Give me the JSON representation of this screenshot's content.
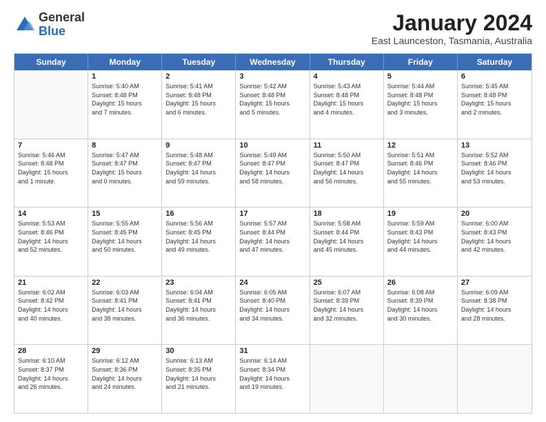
{
  "logo": {
    "general": "General",
    "blue": "Blue"
  },
  "title": "January 2024",
  "subtitle": "East Launceston, Tasmania, Australia",
  "header_days": [
    "Sunday",
    "Monday",
    "Tuesday",
    "Wednesday",
    "Thursday",
    "Friday",
    "Saturday"
  ],
  "weeks": [
    [
      {
        "day": "",
        "text": ""
      },
      {
        "day": "1",
        "text": "Sunrise: 5:40 AM\nSunset: 8:48 PM\nDaylight: 15 hours\nand 7 minutes."
      },
      {
        "day": "2",
        "text": "Sunrise: 5:41 AM\nSunset: 8:48 PM\nDaylight: 15 hours\nand 6 minutes."
      },
      {
        "day": "3",
        "text": "Sunrise: 5:42 AM\nSunset: 8:48 PM\nDaylight: 15 hours\nand 5 minutes."
      },
      {
        "day": "4",
        "text": "Sunrise: 5:43 AM\nSunset: 8:48 PM\nDaylight: 15 hours\nand 4 minutes."
      },
      {
        "day": "5",
        "text": "Sunrise: 5:44 AM\nSunset: 8:48 PM\nDaylight: 15 hours\nand 3 minutes."
      },
      {
        "day": "6",
        "text": "Sunrise: 5:45 AM\nSunset: 8:48 PM\nDaylight: 15 hours\nand 2 minutes."
      }
    ],
    [
      {
        "day": "7",
        "text": "Sunrise: 5:46 AM\nSunset: 8:48 PM\nDaylight: 15 hours\nand 1 minute."
      },
      {
        "day": "8",
        "text": "Sunrise: 5:47 AM\nSunset: 8:47 PM\nDaylight: 15 hours\nand 0 minutes."
      },
      {
        "day": "9",
        "text": "Sunrise: 5:48 AM\nSunset: 8:47 PM\nDaylight: 14 hours\nand 59 minutes."
      },
      {
        "day": "10",
        "text": "Sunrise: 5:49 AM\nSunset: 8:47 PM\nDaylight: 14 hours\nand 58 minutes."
      },
      {
        "day": "11",
        "text": "Sunrise: 5:50 AM\nSunset: 8:47 PM\nDaylight: 14 hours\nand 56 minutes."
      },
      {
        "day": "12",
        "text": "Sunrise: 5:51 AM\nSunset: 8:46 PM\nDaylight: 14 hours\nand 55 minutes."
      },
      {
        "day": "13",
        "text": "Sunrise: 5:52 AM\nSunset: 8:46 PM\nDaylight: 14 hours\nand 53 minutes."
      }
    ],
    [
      {
        "day": "14",
        "text": "Sunrise: 5:53 AM\nSunset: 8:46 PM\nDaylight: 14 hours\nand 52 minutes."
      },
      {
        "day": "15",
        "text": "Sunrise: 5:55 AM\nSunset: 8:45 PM\nDaylight: 14 hours\nand 50 minutes."
      },
      {
        "day": "16",
        "text": "Sunrise: 5:56 AM\nSunset: 8:45 PM\nDaylight: 14 hours\nand 49 minutes."
      },
      {
        "day": "17",
        "text": "Sunrise: 5:57 AM\nSunset: 8:44 PM\nDaylight: 14 hours\nand 47 minutes."
      },
      {
        "day": "18",
        "text": "Sunrise: 5:58 AM\nSunset: 8:44 PM\nDaylight: 14 hours\nand 45 minutes."
      },
      {
        "day": "19",
        "text": "Sunrise: 5:59 AM\nSunset: 8:43 PM\nDaylight: 14 hours\nand 44 minutes."
      },
      {
        "day": "20",
        "text": "Sunrise: 6:00 AM\nSunset: 8:43 PM\nDaylight: 14 hours\nand 42 minutes."
      }
    ],
    [
      {
        "day": "21",
        "text": "Sunrise: 6:02 AM\nSunset: 8:42 PM\nDaylight: 14 hours\nand 40 minutes."
      },
      {
        "day": "22",
        "text": "Sunrise: 6:03 AM\nSunset: 8:41 PM\nDaylight: 14 hours\nand 38 minutes."
      },
      {
        "day": "23",
        "text": "Sunrise: 6:04 AM\nSunset: 8:41 PM\nDaylight: 14 hours\nand 36 minutes."
      },
      {
        "day": "24",
        "text": "Sunrise: 6:05 AM\nSunset: 8:40 PM\nDaylight: 14 hours\nand 34 minutes."
      },
      {
        "day": "25",
        "text": "Sunrise: 6:07 AM\nSunset: 8:39 PM\nDaylight: 14 hours\nand 32 minutes."
      },
      {
        "day": "26",
        "text": "Sunrise: 6:08 AM\nSunset: 8:39 PM\nDaylight: 14 hours\nand 30 minutes."
      },
      {
        "day": "27",
        "text": "Sunrise: 6:09 AM\nSunset: 8:38 PM\nDaylight: 14 hours\nand 28 minutes."
      }
    ],
    [
      {
        "day": "28",
        "text": "Sunrise: 6:10 AM\nSunset: 8:37 PM\nDaylight: 14 hours\nand 26 minutes."
      },
      {
        "day": "29",
        "text": "Sunrise: 6:12 AM\nSunset: 8:36 PM\nDaylight: 14 hours\nand 24 minutes."
      },
      {
        "day": "30",
        "text": "Sunrise: 6:13 AM\nSunset: 8:35 PM\nDaylight: 14 hours\nand 21 minutes."
      },
      {
        "day": "31",
        "text": "Sunrise: 6:14 AM\nSunset: 8:34 PM\nDaylight: 14 hours\nand 19 minutes."
      },
      {
        "day": "",
        "text": ""
      },
      {
        "day": "",
        "text": ""
      },
      {
        "day": "",
        "text": ""
      }
    ]
  ]
}
